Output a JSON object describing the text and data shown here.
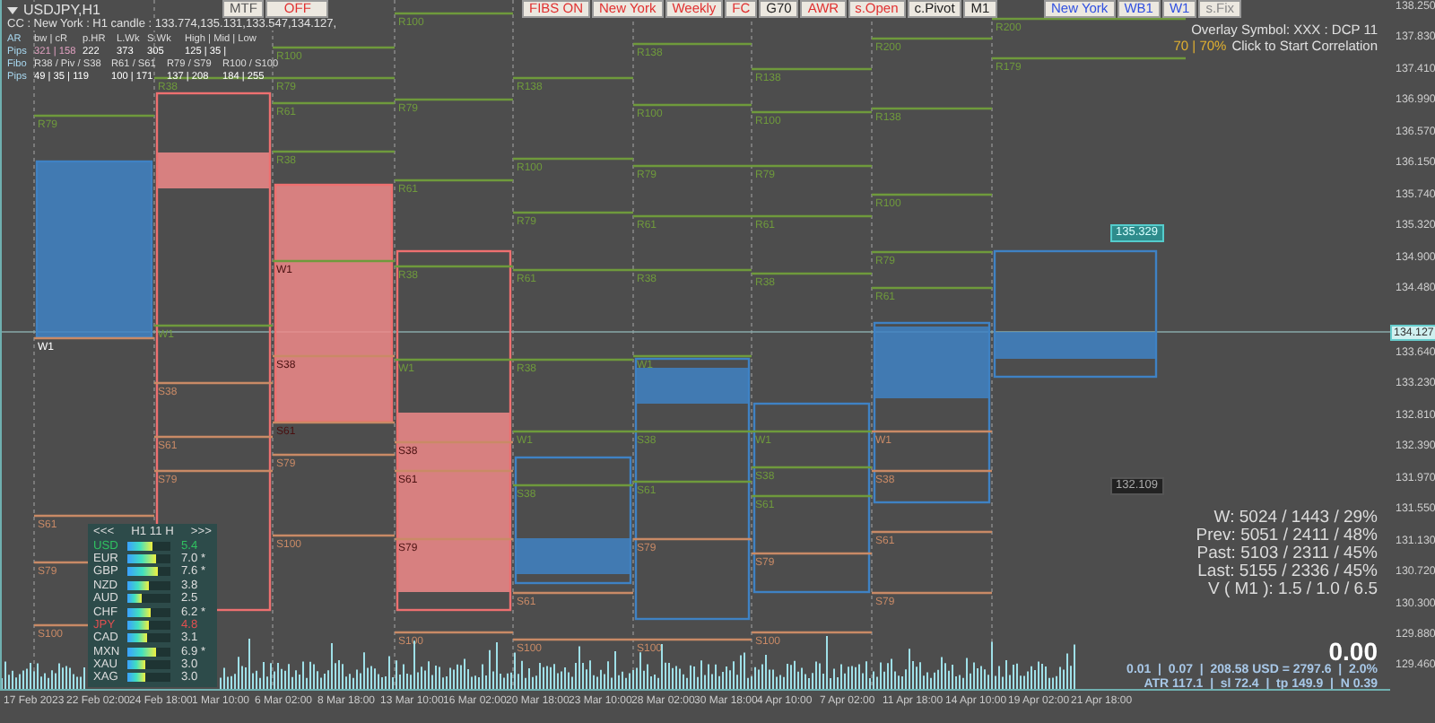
{
  "symbol": {
    "title": "USDJPY,H1",
    "candle": "CC : New York : H1 candle : 133.774,135.131,133.547,134.127,"
  },
  "ar_table": {
    "heads": [
      "AR",
      "bw | cR",
      "p.HR",
      "L.Wk",
      "S.Wk",
      "High | Mid | Low"
    ],
    "values": [
      "Pips",
      "321 | 158",
      "222",
      "373",
      "305",
      "125 | 35 |"
    ]
  },
  "fibo_table": {
    "heads": [
      "Fibo",
      "R38 / Piv / S38",
      "R61 / S61",
      "R79 / S79",
      "R100 / S100"
    ],
    "values": [
      "Pips",
      "49 | 35 | 119",
      "100 | 171",
      "137 | 208",
      "184 | 255"
    ]
  },
  "mtf_buttons": [
    {
      "label": "MTF",
      "color": "#555555"
    },
    {
      "label": "OFF",
      "color": "#e03030"
    }
  ],
  "toolbar": [
    {
      "label": "FIBS ON",
      "color": "#e03030"
    },
    {
      "label": "New York",
      "color": "#e03030"
    },
    {
      "label": "Weekly",
      "color": "#e03030"
    },
    {
      "label": "FC",
      "color": "#e03030"
    },
    {
      "label": "G70",
      "color": "#222222"
    },
    {
      "label": "AWR",
      "color": "#e03030"
    },
    {
      "label": "s.Open",
      "color": "#e03030"
    },
    {
      "label": "c.Pivot",
      "color": "#222222"
    },
    {
      "label": "M1",
      "color": "#222222"
    }
  ],
  "session_buttons": [
    {
      "label": "New York",
      "color": "#3050e0"
    },
    {
      "label": "WB1",
      "color": "#3050e0"
    },
    {
      "label": "W1",
      "color": "#3050e0"
    },
    {
      "label": "s.Fix",
      "color": "#888888"
    }
  ],
  "overlay": {
    "symbol": "Overlay Symbol: XXX : DCP 11",
    "value": "70 | 70%",
    "action": "Click to Start Correlation"
  },
  "weeks": [
    {
      "kind": "bull",
      "levels": [
        "R79",
        "W1",
        "S61",
        "S79",
        "S100"
      ]
    },
    {
      "kind": "bear",
      "levels": [
        "R38",
        "W1",
        "S38",
        "S61",
        "S79"
      ]
    },
    {
      "kind": "bear",
      "levels": [
        "R100",
        "R79",
        "R61",
        "R38",
        "W1",
        "S38",
        "S61",
        "S79",
        "S100"
      ]
    },
    {
      "kind": "bear",
      "levels": [
        "R100",
        "R79",
        "R61",
        "R38",
        "W1",
        "S38",
        "S61",
        "S79",
        "S100"
      ]
    },
    {
      "kind": "bull",
      "levels": [
        "R138",
        "R100",
        "R79",
        "R61",
        "R38",
        "W1",
        "S38",
        "S61",
        "S100"
      ]
    },
    {
      "kind": "bull",
      "levels": [
        "R138",
        "R100",
        "R79",
        "R61",
        "R38",
        "W1",
        "S38",
        "S61",
        "S79",
        "S100"
      ]
    },
    {
      "kind": "bull",
      "levels": [
        "R138",
        "R100",
        "R79",
        "R61",
        "R38",
        "W1",
        "S38",
        "S61",
        "S79",
        "S100"
      ]
    },
    {
      "kind": "bull",
      "levels": [
        "R200",
        "R138",
        "R100",
        "R79",
        "R61",
        "W1",
        "S38",
        "S61",
        "S79"
      ]
    },
    {
      "kind": "bull",
      "levels": [
        "R200",
        "R179"
      ]
    }
  ],
  "price_tags": [
    {
      "label": "135.329",
      "kind": "upper"
    },
    {
      "label": "132.109",
      "kind": "lower"
    }
  ],
  "currencies": {
    "prev": "<<<",
    "period": "H1  11  H",
    "next": ">>>",
    "rows": [
      {
        "name": "USD",
        "color": "#30c060",
        "level": 0.6,
        "value": "5.4"
      },
      {
        "name": "EUR",
        "color": "#dddddd",
        "level": 0.66,
        "value": "7.0 *"
      },
      {
        "name": "GBP",
        "color": "#dddddd",
        "level": 0.7,
        "value": "7.6 *"
      },
      {
        "name": "NZD",
        "color": "#dddddd",
        "level": 0.5,
        "value": "3.8"
      },
      {
        "name": "AUD",
        "color": "#dddddd",
        "level": 0.34,
        "value": "2.5"
      },
      {
        "name": "CHF",
        "color": "#dddddd",
        "level": 0.55,
        "value": "6.2 *"
      },
      {
        "name": "JPY",
        "color": "#e05050",
        "level": 0.5,
        "value": "4.8"
      },
      {
        "name": "CAD",
        "color": "#dddddd",
        "level": 0.45,
        "value": "3.1"
      },
      {
        "name": "MXN",
        "color": "#dddddd",
        "level": 0.66,
        "value": "6.9 *"
      },
      {
        "name": "XAU",
        "color": "#dddddd",
        "level": 0.4,
        "value": "3.0"
      },
      {
        "name": "XAG",
        "color": "#dddddd",
        "level": 0.4,
        "value": "3.0"
      }
    ]
  },
  "stats": [
    "W: 5024 / 1443 / 29%",
    "Prev: 5051 / 2411 / 48%",
    "Past: 5103 / 2311 / 45%",
    "Last: 5155 / 2336 / 45%",
    "V ( M1 ): 1.5 / 1.0 / 6.5"
  ],
  "profit": "0.00",
  "risk_line": "0.01  |  0.07  |  208.58 USD = 2797.6  |  2.0%",
  "atr_line": "ATR 117.1  |  sl 72.4  |  tp 149.9  |  N 0.39",
  "price_axis": [
    "138.250",
    "137.830",
    "137.410",
    "136.990",
    "136.570",
    "136.150",
    "135.740",
    "135.320",
    "134.900",
    "134.480",
    "133.640",
    "133.230",
    "132.810",
    "132.390",
    "131.970",
    "131.550",
    "131.130",
    "130.720",
    "130.300",
    "129.880",
    "129.460"
  ],
  "current_price": "134.127",
  "time_axis": [
    "17 Feb 2023",
    "22 Feb 02:00",
    "24 Feb 18:00",
    "1 Mar 10:00",
    "6 Mar 02:00",
    "8 Mar 18:00",
    "13 Mar 10:00",
    "16 Mar 02:00",
    "20 Mar 18:00",
    "23 Mar 10:00",
    "28 Mar 02:00",
    "30 Mar 18:00",
    "4 Apr 10:00",
    "7 Apr 02:00",
    "11 Apr 18:00",
    "14 Apr 10:00",
    "19 Apr 02:00",
    "21 Apr 18:00"
  ]
}
